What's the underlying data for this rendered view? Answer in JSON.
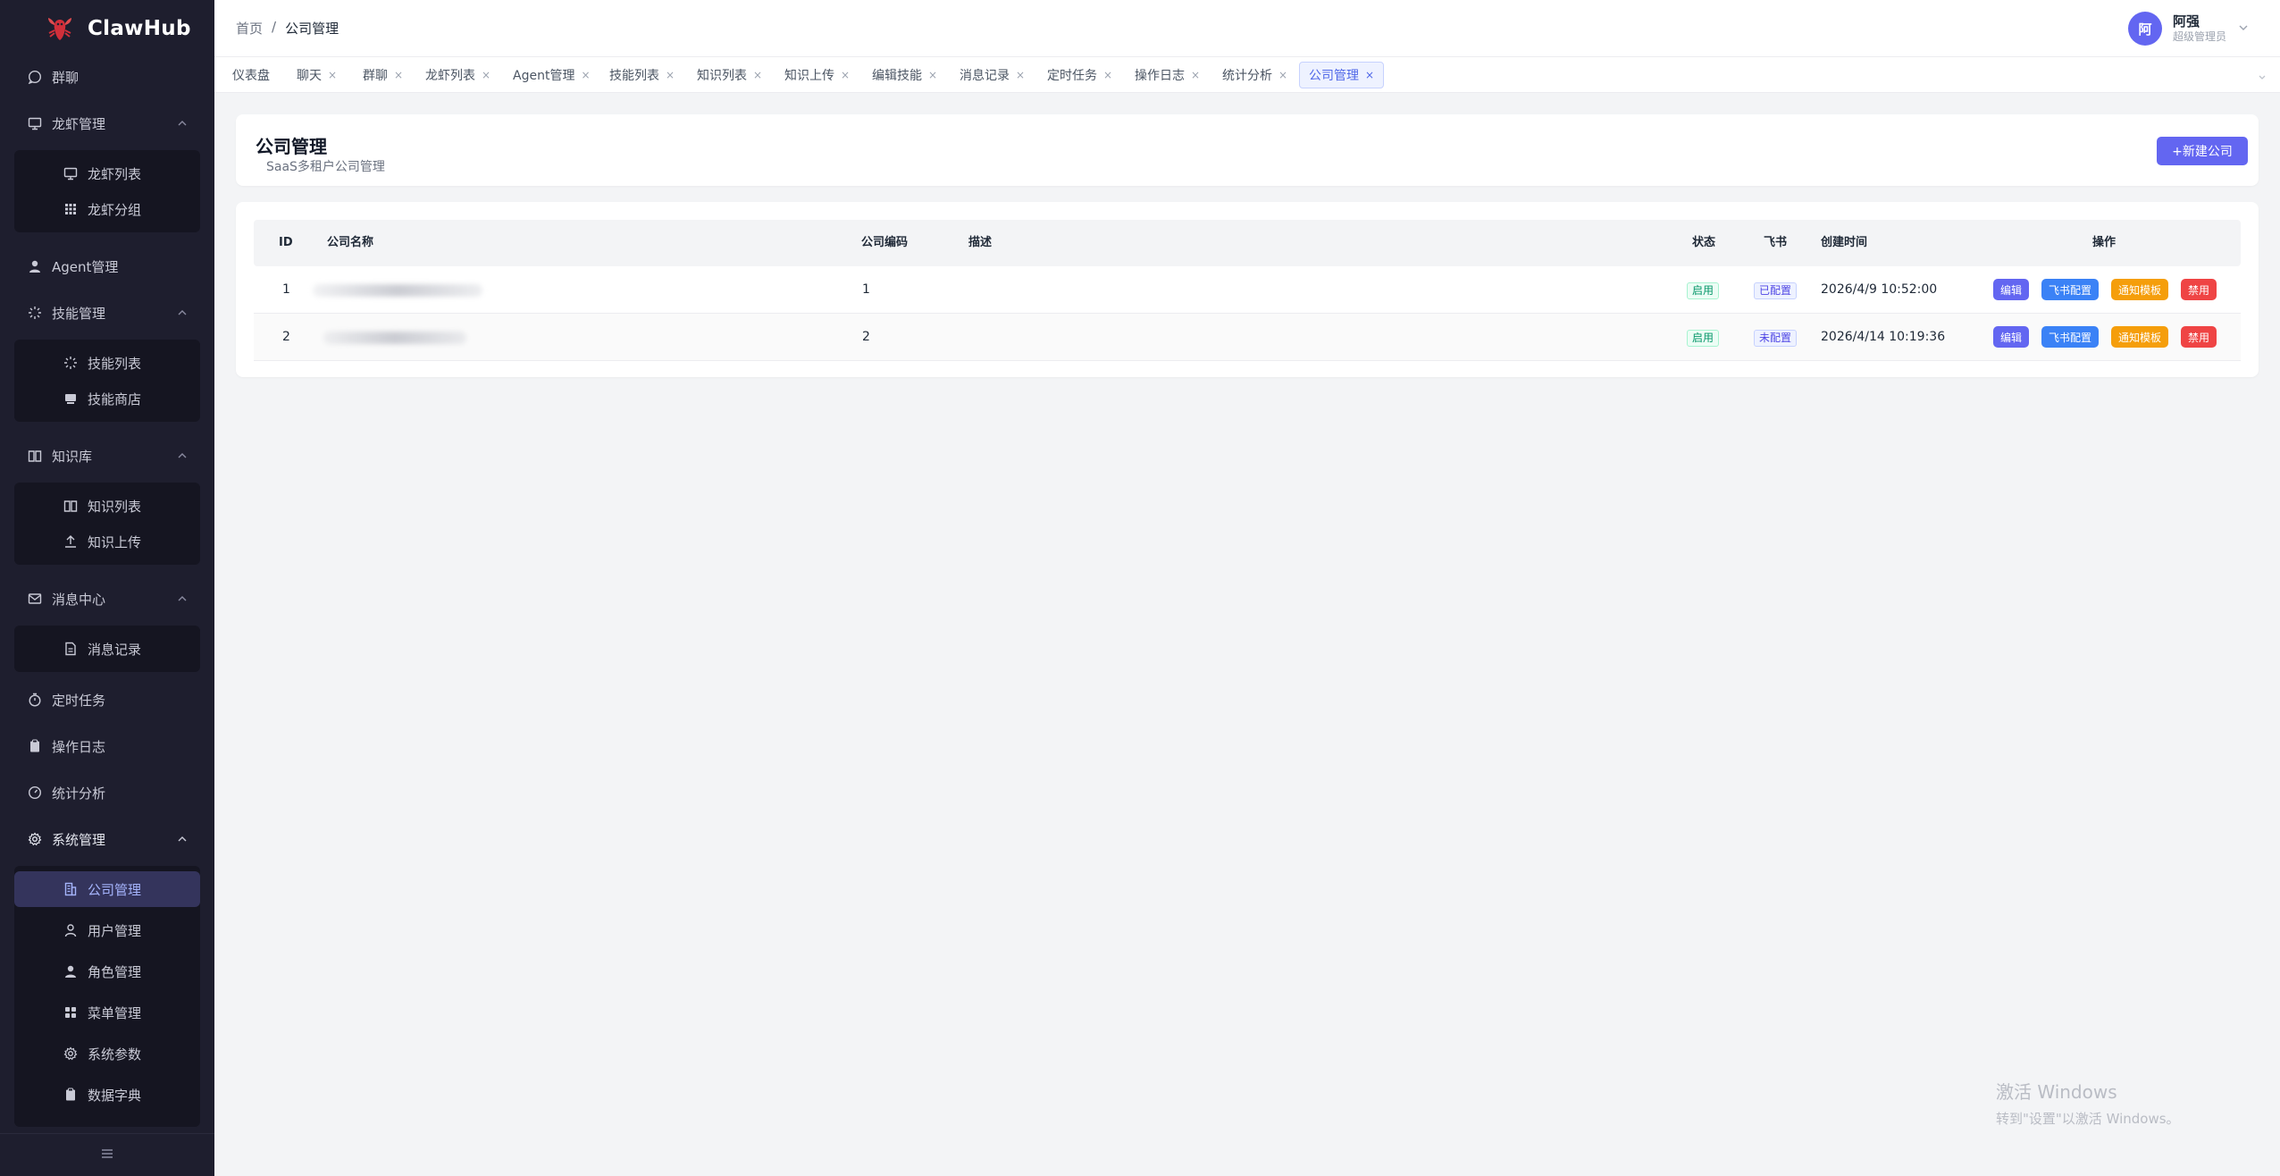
{
  "app": {
    "name": "ClawHub",
    "brand_color": "#6366f1",
    "sidebar_bg": "#1e1e2e"
  },
  "sidebar": {
    "items": [
      {
        "label": "群聊",
        "icon": "chat-icon"
      },
      {
        "label": "龙虾管理",
        "icon": "monitor-icon",
        "expanded": true
      },
      {
        "label": "龙虾列表",
        "icon": "monitor-icon"
      },
      {
        "label": "龙虾分组",
        "icon": "grid-icon"
      },
      {
        "label": "Agent管理",
        "icon": "user-icon"
      },
      {
        "label": "技能管理",
        "icon": "sparkle-icon",
        "expanded": true
      },
      {
        "label": "技能列表",
        "icon": "sparkle-icon"
      },
      {
        "label": "技能商店",
        "icon": "store-icon"
      },
      {
        "label": "知识库",
        "icon": "book-icon",
        "expanded": true
      },
      {
        "label": "知识列表",
        "icon": "book-icon"
      },
      {
        "label": "知识上传",
        "icon": "upload-icon"
      },
      {
        "label": "消息中心",
        "icon": "mail-icon",
        "expanded": true
      },
      {
        "label": "消息记录",
        "icon": "document-icon"
      },
      {
        "label": "定时任务",
        "icon": "timer-icon"
      },
      {
        "label": "操作日志",
        "icon": "clipboard-icon"
      },
      {
        "label": "统计分析",
        "icon": "gauge-icon"
      },
      {
        "label": "系统管理",
        "icon": "gear-icon",
        "expanded": true
      },
      {
        "label": "公司管理",
        "icon": "building-icon",
        "active": true
      },
      {
        "label": "用户管理",
        "icon": "user-outline-icon"
      },
      {
        "label": "角色管理",
        "icon": "user-icon"
      },
      {
        "label": "菜单管理",
        "icon": "grid-icon"
      },
      {
        "label": "系统参数",
        "icon": "gear-icon"
      },
      {
        "label": "数据字典",
        "icon": "clipboard-icon"
      }
    ]
  },
  "header": {
    "breadcrumb": {
      "home": "首页",
      "separator": "/",
      "current": "公司管理"
    },
    "user": {
      "avatar_text": "阿",
      "name": "阿强",
      "role": "超级管理员"
    }
  },
  "tabs": [
    {
      "label": "仪表盘",
      "closable": false
    },
    {
      "label": "聊天",
      "closable": true
    },
    {
      "label": "群聊",
      "closable": true
    },
    {
      "label": "龙虾列表",
      "closable": true
    },
    {
      "label": "Agent管理",
      "closable": true
    },
    {
      "label": "技能列表",
      "closable": true
    },
    {
      "label": "知识列表",
      "closable": true
    },
    {
      "label": "知识上传",
      "closable": true
    },
    {
      "label": "编辑技能",
      "closable": true
    },
    {
      "label": "消息记录",
      "closable": true
    },
    {
      "label": "定时任务",
      "closable": true
    },
    {
      "label": "操作日志",
      "closable": true
    },
    {
      "label": "统计分析",
      "closable": true
    },
    {
      "label": "公司管理",
      "closable": true,
      "active": true
    }
  ],
  "tab_close_glyph": "×",
  "page": {
    "title": "公司管理",
    "subtitle": "SaaS多租户公司管理",
    "new_button": "+新建公司"
  },
  "table": {
    "columns": [
      "ID",
      "公司名称",
      "公司编码",
      "描述",
      "状态",
      "飞书",
      "创建时间",
      "操作"
    ],
    "rows": [
      {
        "id": "1",
        "name": "",
        "code": "1",
        "desc": "",
        "status": "启用",
        "feishu": "已配置",
        "created": "2026/4/9 10:52:00"
      },
      {
        "id": "2",
        "name": "",
        "code": "2",
        "desc": "",
        "status": "启用",
        "feishu": "未配置",
        "created": "2026/4/14 10:19:36"
      }
    ],
    "actions": {
      "edit": "编辑",
      "feishu": "飞书配置",
      "notify": "通知模板",
      "disable": "禁用"
    }
  },
  "watermark": {
    "line1": "激活 Windows",
    "line2": "转到\"设置\"以激活 Windows。"
  }
}
